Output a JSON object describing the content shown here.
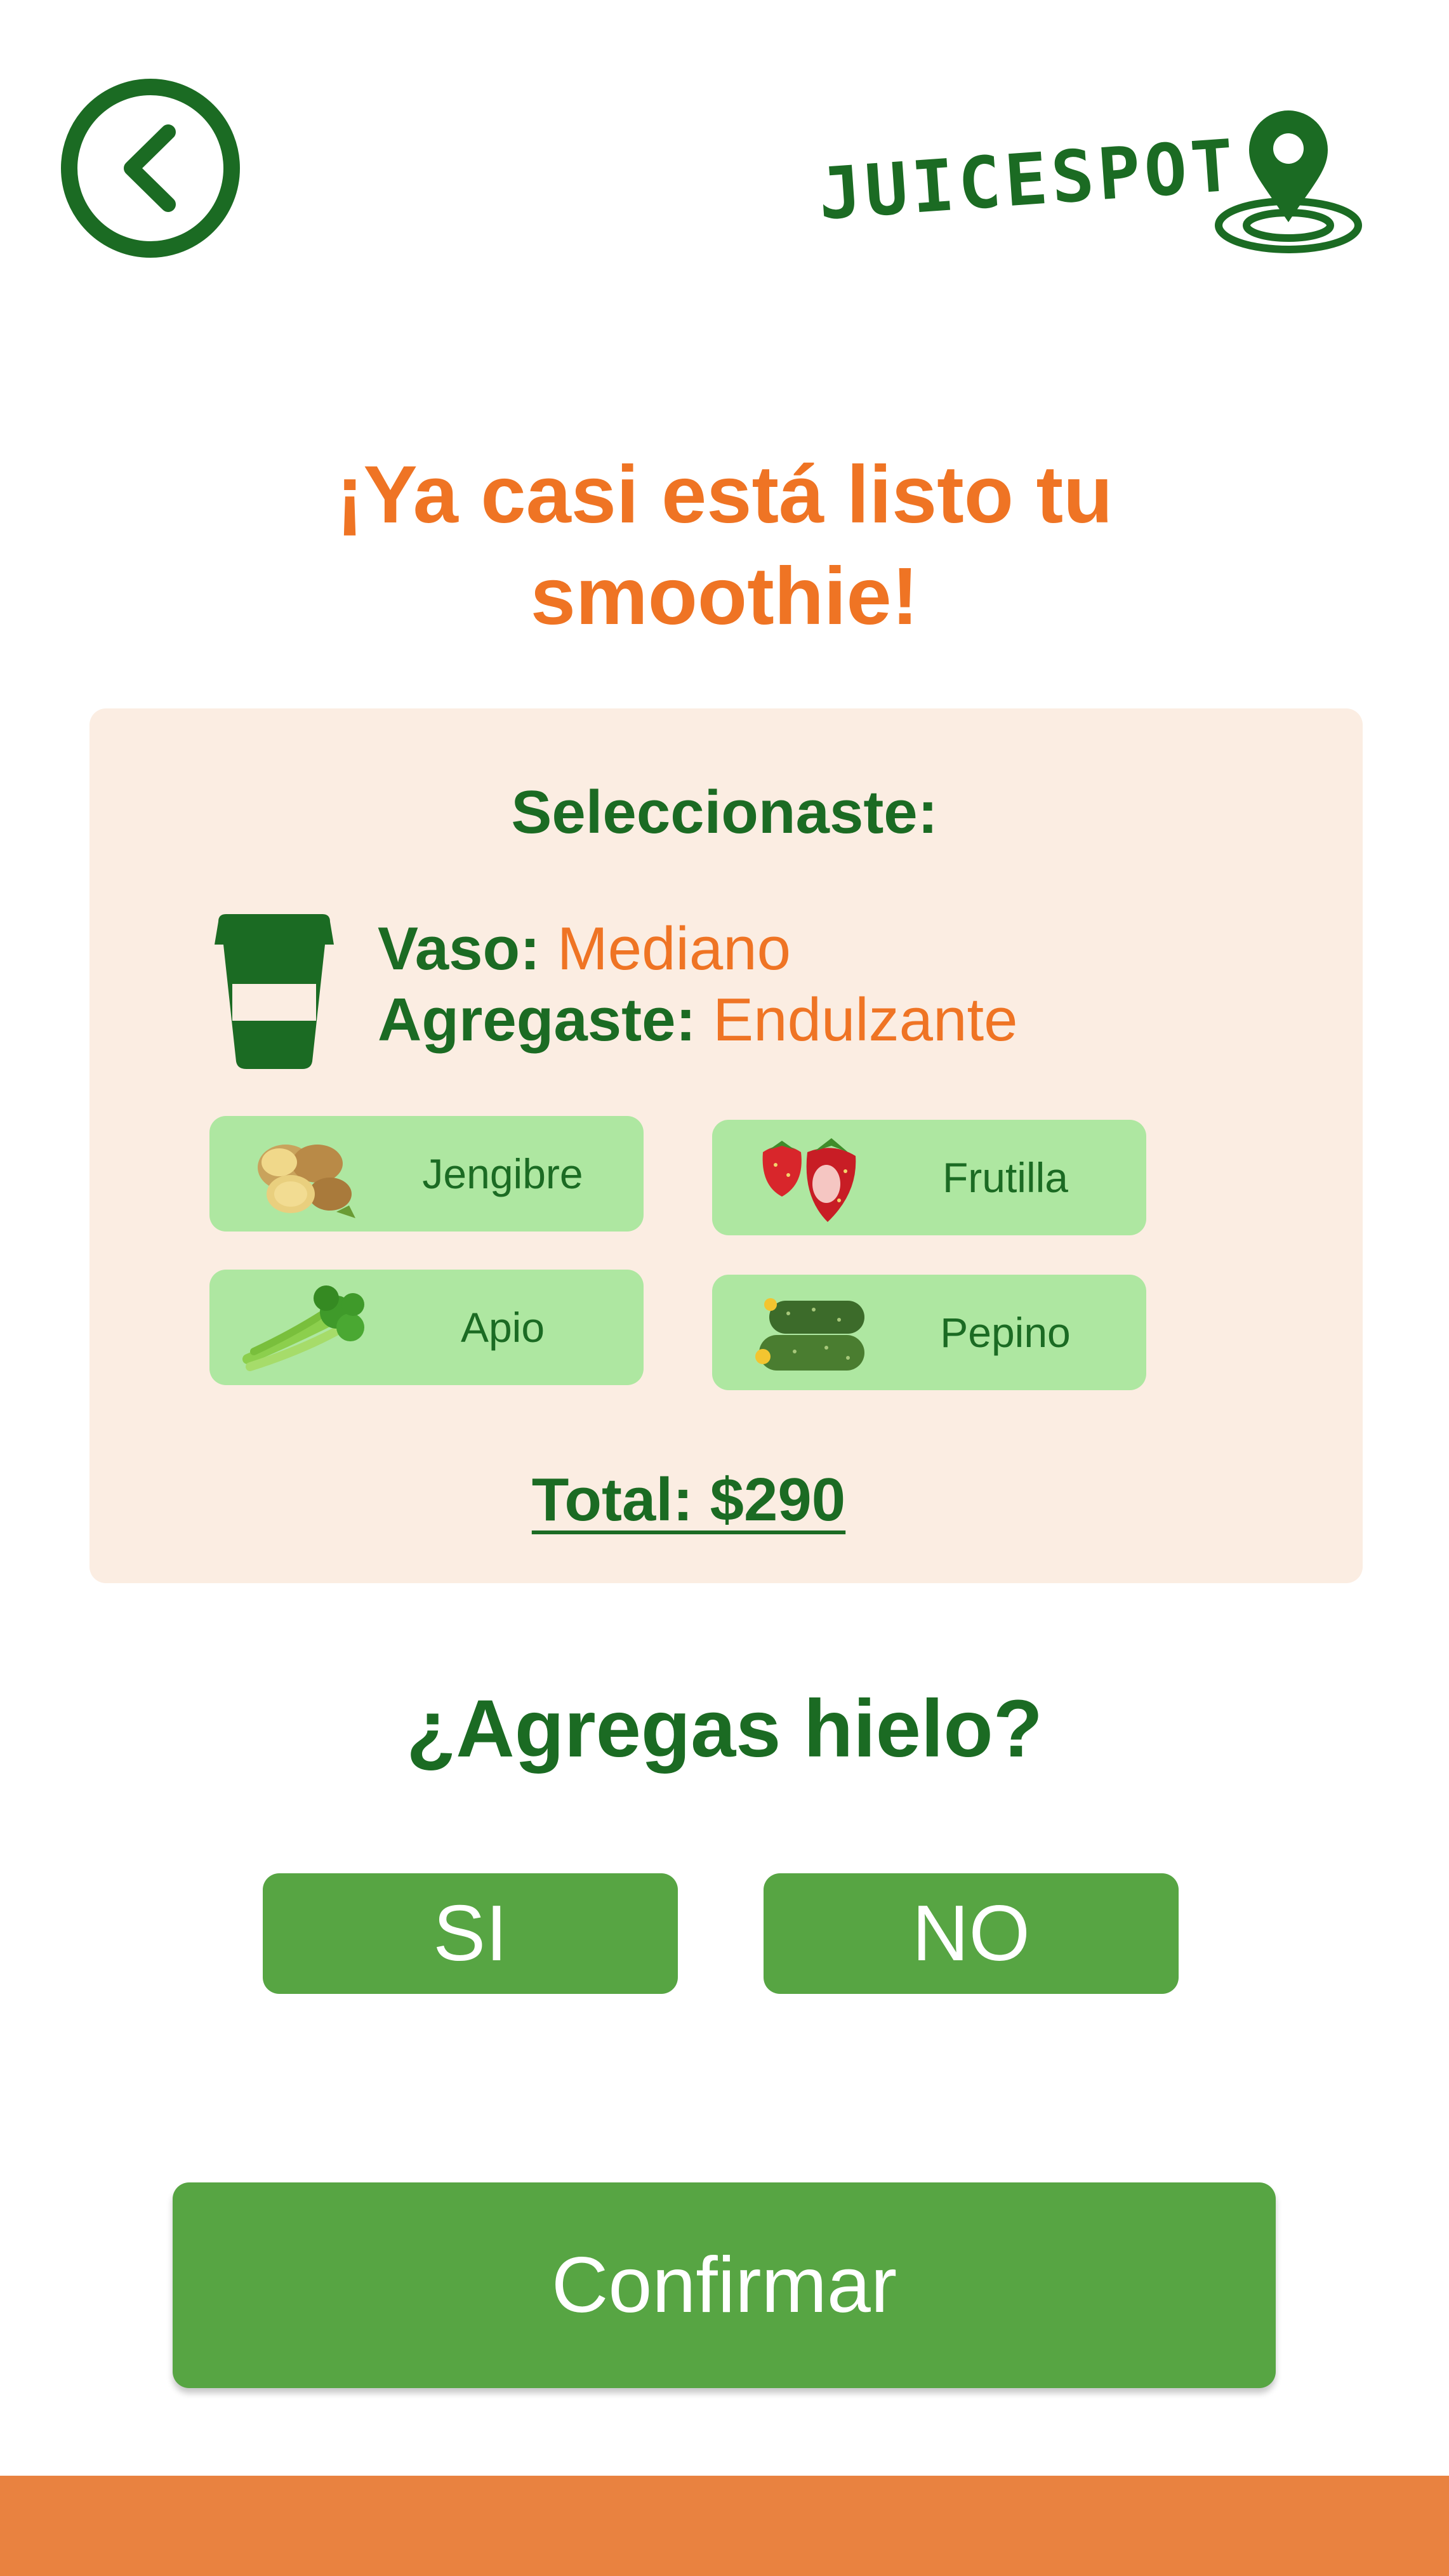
{
  "header": {
    "back_icon": "chevron-left-icon",
    "logo_text": "JUICESPOT",
    "logo_icon": "map-pin-icon"
  },
  "headline": {
    "line1": "¡Ya casi está listo tu",
    "line2": "smoothie!"
  },
  "summary": {
    "title": "Seleccionaste:",
    "cup_icon": "cup-icon",
    "size_label": "Vaso:",
    "size_value": "Mediano",
    "extra_label": "Agregaste:",
    "extra_value": "Endulzante",
    "ingredients": [
      {
        "label": "Jengibre",
        "icon": "ginger-image"
      },
      {
        "label": "Frutilla",
        "icon": "strawberry-image"
      },
      {
        "label": "Apio",
        "icon": "celery-image"
      },
      {
        "label": "Pepino",
        "icon": "cucumber-image"
      }
    ],
    "total": "Total: $290"
  },
  "ice": {
    "question": "¿Agregas hielo?",
    "yes_label": "SI",
    "no_label": "NO"
  },
  "confirm_label": "Confirmar",
  "colors": {
    "primary_green": "#1b6b23",
    "button_green": "#57a543",
    "chip_green": "#aee7a1",
    "accent_orange": "#ef7424",
    "card_bg": "#fbede2",
    "bottom_bar": "#e98240"
  }
}
